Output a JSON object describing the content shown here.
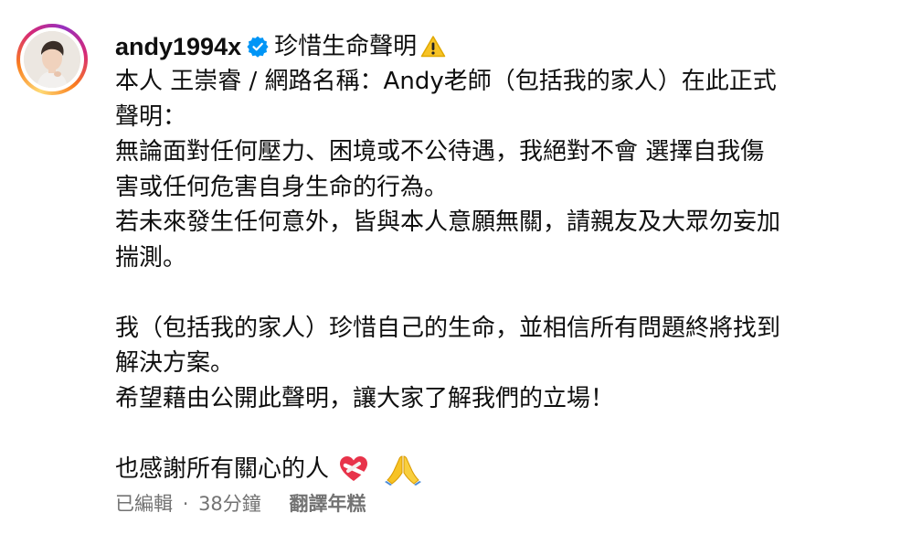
{
  "post": {
    "username": "andy1994x",
    "caption_title": "珍惜生命聲明",
    "caption_lines": [
      "本人 王崇睿 / 網路名稱：Andy老師（包括我的家人）在此正式",
      "聲明：",
      "無論面對任何壓力、困境或不公待遇，我絕對不會 選擇自我傷",
      "害或任何危害自身生命的行為。",
      "若未來發生任何意外，皆與本人意願無關，請親友及大眾勿妄加",
      "揣測。",
      "",
      "我（包括我的家人）珍惜自己的生命，並相信所有問題終將找到",
      "解決方案。",
      "希望藉由公開此聲明，讓大家了解我們的立場！",
      "",
      "也感謝所有關心的人"
    ],
    "edited_label": "已編輯",
    "separator": "·",
    "time_ago": "38分鐘",
    "translate_label": "翻譯年糕"
  },
  "icons": {
    "verified": "verified-badge-icon",
    "warning": "warning-emoji",
    "heart": "mending-heart-emoji",
    "pray": "folded-hands-emoji"
  },
  "colors": {
    "verified_blue": "#0095f6",
    "warning_yellow": "#f7c325",
    "heart_red": "#e8334a",
    "meta_gray": "#737373"
  }
}
